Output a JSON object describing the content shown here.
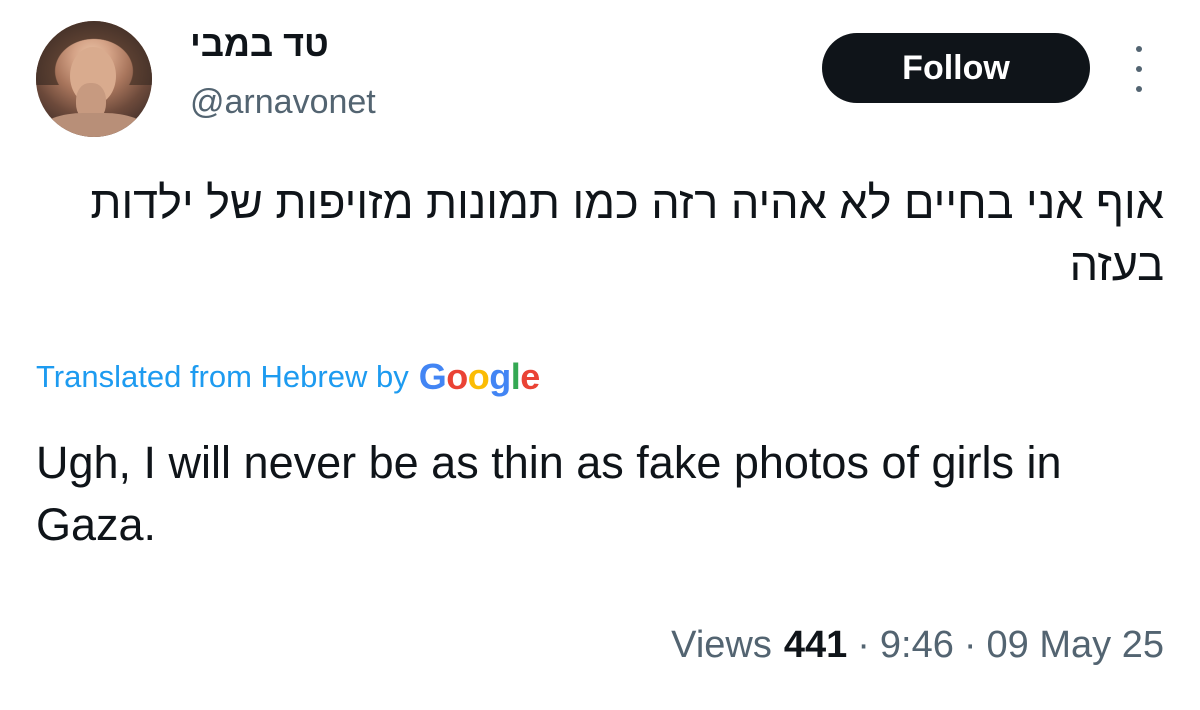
{
  "author": {
    "display_name": "טד במבי",
    "handle": "@arnavonet"
  },
  "follow_label": "Follow",
  "tweet": {
    "text_original": "אוף אני בחיים לא אהיה רזה כמו תמונות מזויפות של ילדות בעזה",
    "translation_label": "Translated from Hebrew by",
    "translation_provider": "Google",
    "text_translated": "Ugh, I will never be as thin as fake photos of girls in Gaza."
  },
  "meta": {
    "views_label": "Views",
    "views_count": "441",
    "separator": "·",
    "time": "9:46",
    "date": "09 May 25"
  },
  "colors": {
    "link": "#1d9bf0",
    "text": "#0f1419",
    "secondary": "#536471",
    "follow_bg": "#0f1419"
  },
  "icons": {
    "more": "more-vertical-icon",
    "google": "google-logo"
  }
}
